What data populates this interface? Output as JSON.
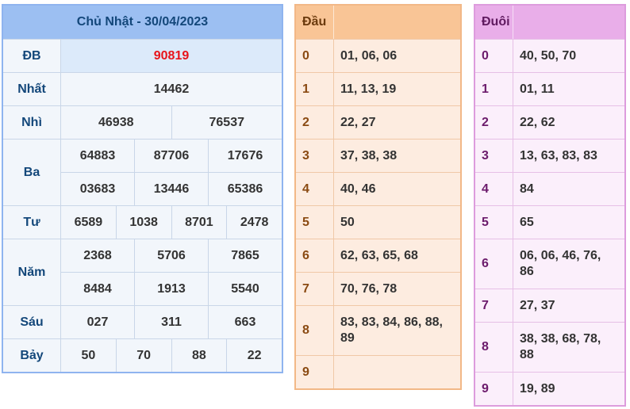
{
  "results": {
    "title": "Chủ Nhật - 30/04/2023",
    "rows": [
      {
        "label": "ĐB",
        "lines": [
          [
            "90819"
          ]
        ]
      },
      {
        "label": "Nhất",
        "lines": [
          [
            "14462"
          ]
        ]
      },
      {
        "label": "Nhì",
        "lines": [
          [
            "46938",
            "76537"
          ]
        ]
      },
      {
        "label": "Ba",
        "lines": [
          [
            "64883",
            "87706",
            "17676"
          ],
          [
            "03683",
            "13446",
            "65386"
          ]
        ]
      },
      {
        "label": "Tư",
        "lines": [
          [
            "6589",
            "1038",
            "8701",
            "2478"
          ]
        ]
      },
      {
        "label": "Năm",
        "lines": [
          [
            "2368",
            "5706",
            "7865"
          ],
          [
            "8484",
            "1913",
            "5540"
          ]
        ]
      },
      {
        "label": "Sáu",
        "lines": [
          [
            "027",
            "311",
            "663"
          ]
        ]
      },
      {
        "label": "Bảy",
        "lines": [
          [
            "50",
            "70",
            "88",
            "22"
          ]
        ]
      }
    ],
    "special_color": "#e8141b"
  },
  "dau": {
    "header": "Đầu",
    "rows": [
      {
        "key": "0",
        "values": "01, 06, 06"
      },
      {
        "key": "1",
        "values": "11, 13, 19"
      },
      {
        "key": "2",
        "values": "22, 27"
      },
      {
        "key": "3",
        "values": "37, 38, 38"
      },
      {
        "key": "4",
        "values": "40, 46"
      },
      {
        "key": "5",
        "values": "50"
      },
      {
        "key": "6",
        "values": "62, 63, 65, 68"
      },
      {
        "key": "7",
        "values": "70, 76, 78"
      },
      {
        "key": "8",
        "values": "83, 83, 84, 86, 88, 89"
      },
      {
        "key": "9",
        "values": ""
      }
    ]
  },
  "duoi": {
    "header": "Đuôi",
    "rows": [
      {
        "key": "0",
        "values": "40, 50, 70"
      },
      {
        "key": "1",
        "values": "01, 11"
      },
      {
        "key": "2",
        "values": "22, 62"
      },
      {
        "key": "3",
        "values": "13, 63, 83, 83"
      },
      {
        "key": "4",
        "values": "84"
      },
      {
        "key": "5",
        "values": "65"
      },
      {
        "key": "6",
        "values": "06, 06, 46, 76, 86"
      },
      {
        "key": "7",
        "values": "27, 37"
      },
      {
        "key": "8",
        "values": "38, 38, 68, 78, 88"
      },
      {
        "key": "9",
        "values": "19, 89"
      }
    ]
  }
}
